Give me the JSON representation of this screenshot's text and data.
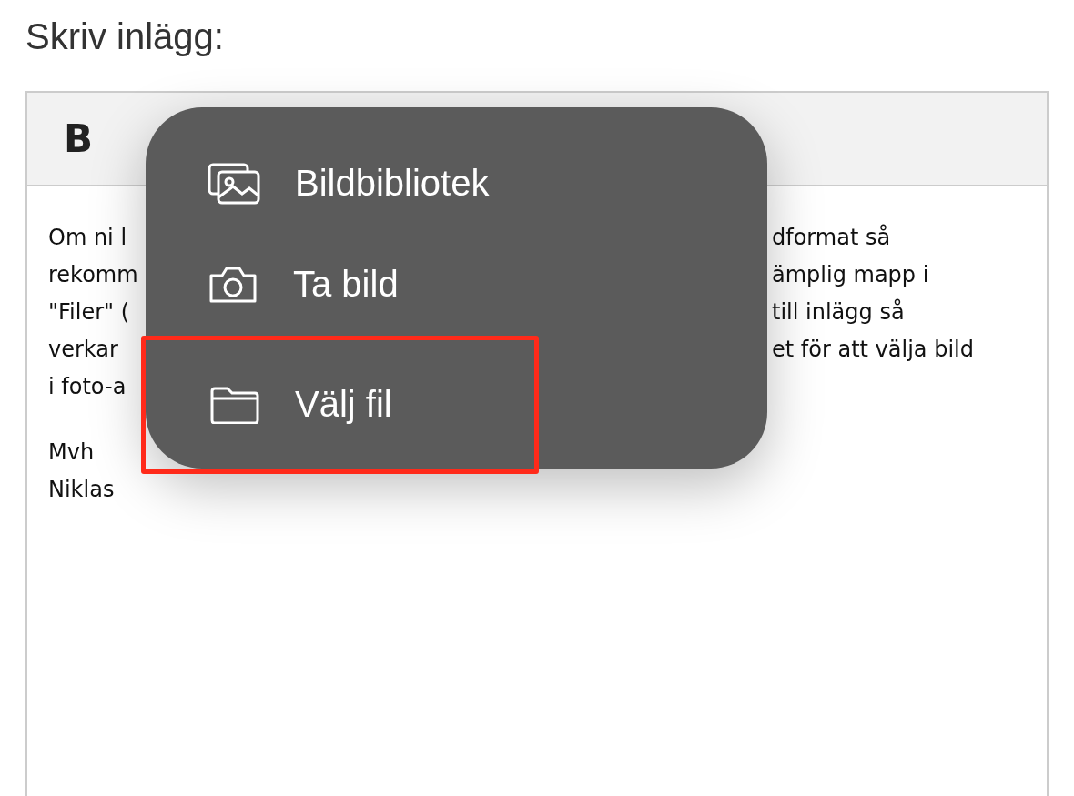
{
  "heading": "Skriv inlägg:",
  "toolbar": {
    "buttons": [
      {
        "kind": "bold",
        "label": "B"
      }
    ]
  },
  "body_lines": [
    {
      "left": "Om ni l",
      "right": "dformat så"
    },
    {
      "left": "rekomm",
      "right": "ämplig mapp i"
    },
    {
      "left": "\"Filer\" (",
      "right": "till inlägg så"
    },
    {
      "left": "verkar",
      "right": "et för att välja bild"
    },
    {
      "left": "i foto-a"
    }
  ],
  "signature": [
    "Mvh",
    "Niklas"
  ],
  "menu": {
    "items": [
      {
        "kind": "photos",
        "label": "Bildbibliotek",
        "highlighted": false
      },
      {
        "kind": "camera",
        "label": "Ta bild",
        "highlighted": false
      },
      {
        "kind": "folder",
        "label": "Välj fil",
        "highlighted": true
      }
    ]
  }
}
